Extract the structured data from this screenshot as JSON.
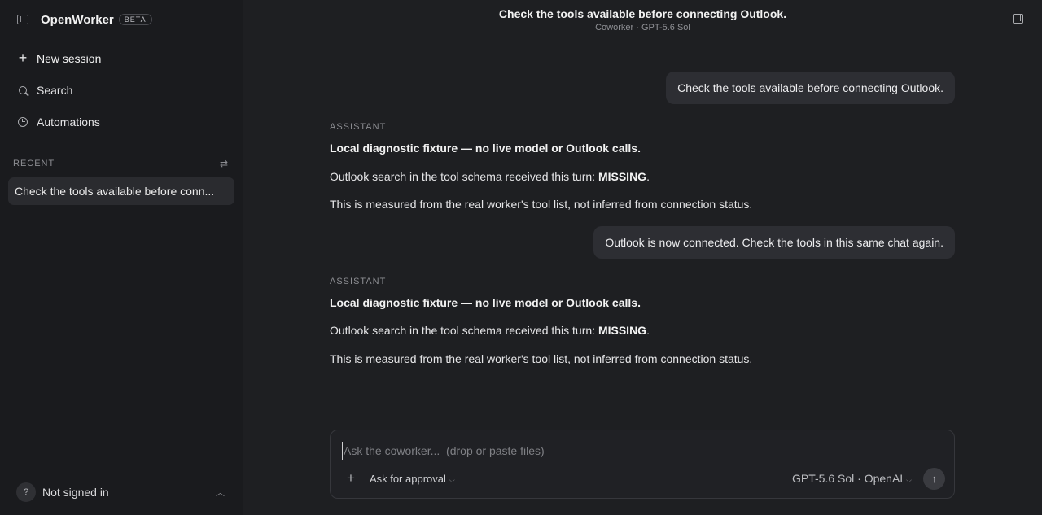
{
  "sidebar": {
    "app_name": "OpenWorker",
    "badge": "BETA",
    "nav": [
      {
        "label": "New session",
        "icon": "plus-icon"
      },
      {
        "label": "Search",
        "icon": "search-icon"
      },
      {
        "label": "Automations",
        "icon": "clock-icon"
      }
    ],
    "recent_label": "RECENT",
    "recent_items": [
      {
        "label": "Check the tools available before conn..."
      }
    ],
    "account": {
      "avatar": "?",
      "label": "Not signed in"
    }
  },
  "header": {
    "title": "Check the tools available before connecting Outlook.",
    "subtitle": "Coworker · GPT-5.6 Sol"
  },
  "thread": {
    "messages": [
      {
        "role": "user",
        "text": "Check the tools available before connecting Outlook."
      },
      {
        "role": "assistant",
        "role_label": "ASSISTANT",
        "heading": "Local diagnostic fixture — no live model or Outlook calls.",
        "line1_prefix": "Outlook search in the tool schema received this turn: ",
        "line1_status": "MISSING",
        "line1_suffix": ".",
        "line2": "This is measured from the real worker's tool list, not inferred from connection status."
      },
      {
        "role": "user",
        "text": "Outlook is now connected. Check the tools in this same chat again."
      },
      {
        "role": "assistant",
        "role_label": "ASSISTANT",
        "heading": "Local diagnostic fixture — no live model or Outlook calls.",
        "line1_prefix": "Outlook search in the tool schema received this turn: ",
        "line1_status": "MISSING",
        "line1_suffix": ".",
        "line2": "This is measured from the real worker's tool list, not inferred from connection status."
      }
    ]
  },
  "composer": {
    "placeholder": "Ask the coworker...  (drop or paste files)",
    "value": "",
    "approval_label": "Ask for approval",
    "model_label": "GPT-5.6 Sol · OpenAI"
  }
}
